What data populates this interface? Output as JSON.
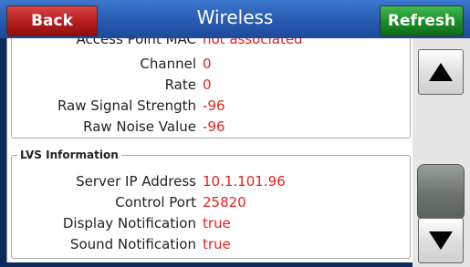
{
  "header": {
    "back_label": "Back",
    "title": "Wireless",
    "refresh_label": "Refresh"
  },
  "wifi": {
    "partial_label": "Access Point MAC",
    "partial_value": "not associated",
    "rows": [
      {
        "label": "Channel",
        "value": "0"
      },
      {
        "label": "Rate",
        "value": "0"
      },
      {
        "label": "Raw Signal Strength",
        "value": "-96"
      },
      {
        "label": "Raw Noise Value",
        "value": "-96"
      }
    ]
  },
  "lvs": {
    "title": "LVS Information",
    "rows": [
      {
        "label": "Server IP Address",
        "value": "10.1.101.96"
      },
      {
        "label": "Control Port",
        "value": "25820"
      },
      {
        "label": "Display Notification",
        "value": "true"
      },
      {
        "label": "Sound Notification",
        "value": "true"
      }
    ]
  },
  "icons": {
    "scroll_up": "up-arrow-icon",
    "scroll_down": "down-arrow-icon"
  }
}
